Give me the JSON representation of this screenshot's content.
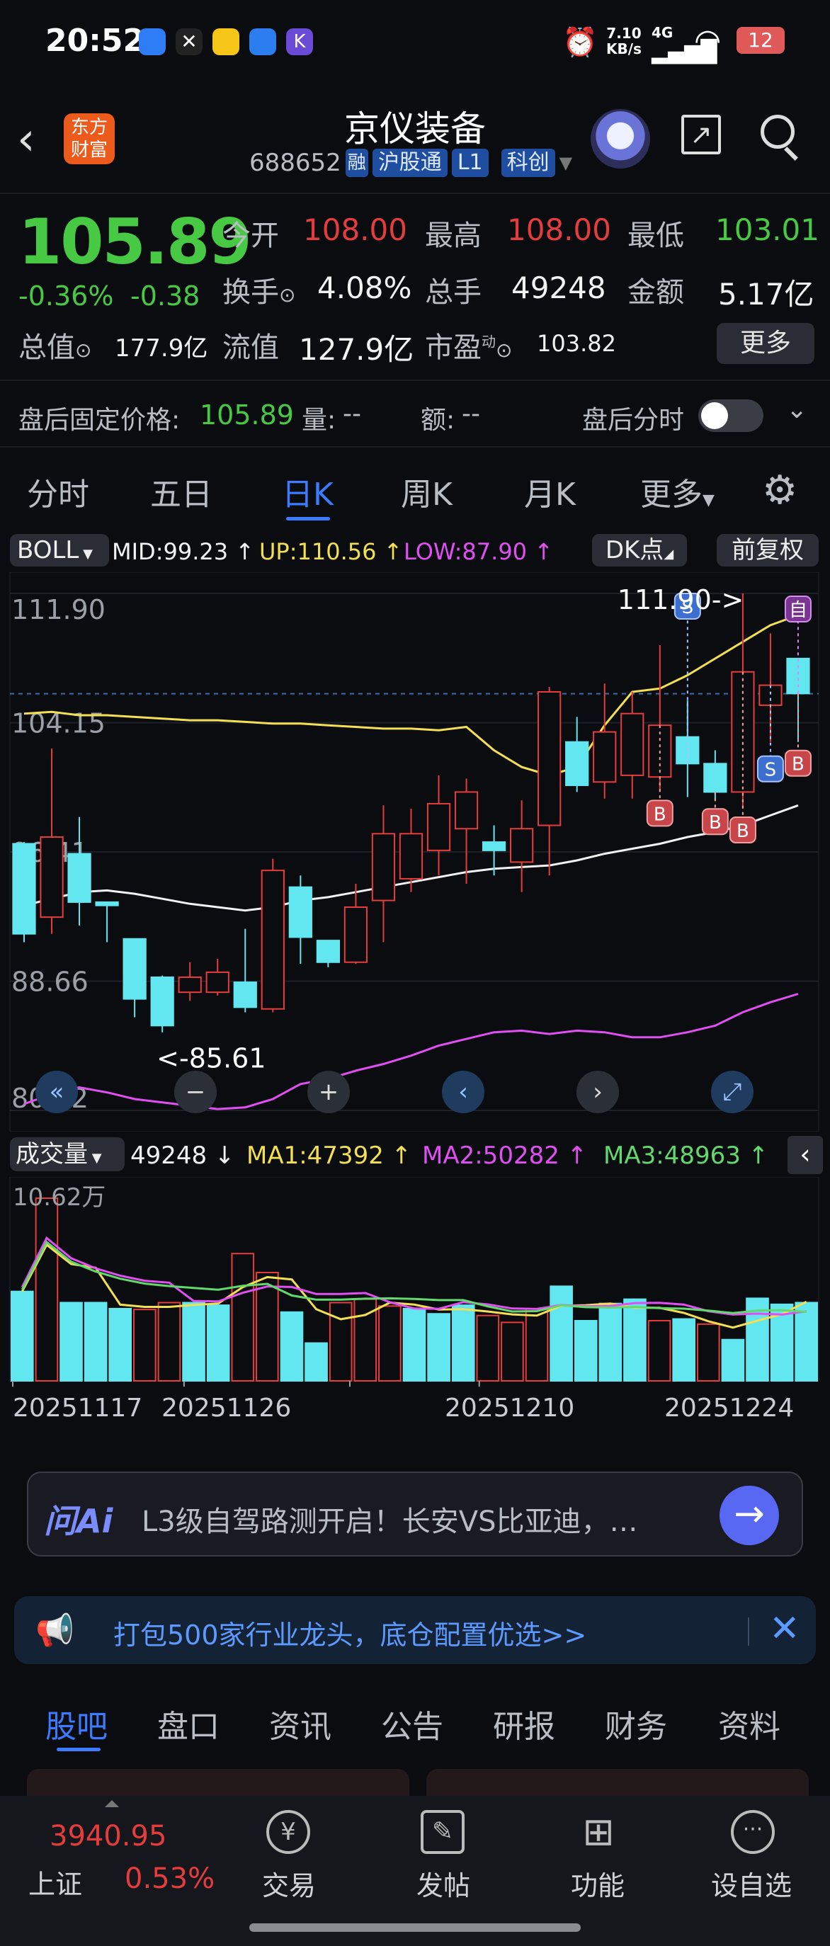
{
  "status_bar": {
    "time": "20:52",
    "net_speed_top": "7.10",
    "net_speed_bottom": "KB/s",
    "signal": "4G",
    "battery": "12"
  },
  "header": {
    "title": "京仪装备",
    "code": "688652",
    "badges": [
      "融",
      "沪股通",
      "L1",
      "科创"
    ],
    "logo_line1": "东方",
    "logo_line2": "财富"
  },
  "quote": {
    "price": "105.89",
    "change_pct": "-0.36%",
    "change_abs": "-0.38",
    "open_label": "今开",
    "open": "108.00",
    "high_label": "最高",
    "high": "108.00",
    "low_label": "最低",
    "low": "103.01",
    "turnover_label": "换手",
    "turnover": "4.08%",
    "volume_label": "总手",
    "volume": "49248",
    "amount_label": "金额",
    "amount": "5.17亿",
    "mktcap_label": "总值",
    "mktcap": "177.9亿",
    "float_label": "流值",
    "float": "127.9亿",
    "pe_label": "市盈",
    "pe_sup": "动",
    "pe": "103.82",
    "more_label": "更多"
  },
  "after_hours": {
    "price_label": "盘后固定价格:",
    "price": "105.89",
    "vol_label": "量:",
    "vol": "--",
    "amt_label": "额:",
    "amt": "--",
    "toggle_label": "盘后分时"
  },
  "period_tabs": [
    "分时",
    "五日",
    "日K",
    "周K",
    "月K",
    "更多"
  ],
  "active_tab": 2,
  "boll": {
    "name": "BOLL",
    "mid": "MID:99.23",
    "up": "UP:110.56",
    "low": "LOW:87.90",
    "dk": "DK点",
    "adjust": "前复权"
  },
  "chart_data": {
    "type": "candlestick",
    "y_ticks": [
      "111.90",
      "104.15",
      "96.41",
      "88.66",
      "80.92"
    ],
    "ylim": [
      80.92,
      111.9
    ],
    "max_label": "111.90->",
    "min_label": "<-85.61",
    "candles": [
      {
        "o": 96.9,
        "h": 97.0,
        "c": 91.5,
        "l": 91.0
      },
      {
        "o": 92.5,
        "h": 102.6,
        "c": 97.3,
        "l": 91.5
      },
      {
        "o": 96.3,
        "h": 98.5,
        "c": 93.4,
        "l": 92.0
      },
      {
        "o": 93.4,
        "h": 93.4,
        "c": 93.2,
        "l": 91.0
      },
      {
        "o": 91.2,
        "h": 91.2,
        "c": 87.6,
        "l": 86.5
      },
      {
        "o": 88.9,
        "h": 89.0,
        "c": 86.0,
        "l": 85.6
      },
      {
        "o": 88.0,
        "h": 89.8,
        "c": 88.9,
        "l": 87.5
      },
      {
        "o": 88.0,
        "h": 90.0,
        "c": 89.2,
        "l": 87.8
      },
      {
        "o": 88.6,
        "h": 91.8,
        "c": 87.1,
        "l": 86.8
      },
      {
        "o": 87.0,
        "h": 96.0,
        "c": 95.3,
        "l": 86.8
      },
      {
        "o": 94.3,
        "h": 95.0,
        "c": 91.3,
        "l": 89.7
      },
      {
        "o": 91.1,
        "h": 91.1,
        "c": 89.8,
        "l": 89.5
      },
      {
        "o": 89.8,
        "h": 94.5,
        "c": 93.1,
        "l": 89.7
      },
      {
        "o": 93.5,
        "h": 99.2,
        "c": 97.5,
        "l": 91.0
      },
      {
        "o": 94.8,
        "h": 99.0,
        "c": 97.5,
        "l": 94.0
      },
      {
        "o": 96.5,
        "h": 101.0,
        "c": 99.3,
        "l": 95.0
      },
      {
        "o": 97.8,
        "h": 100.8,
        "c": 100.0,
        "l": 94.5
      },
      {
        "o": 97.0,
        "h": 98.0,
        "c": 96.5,
        "l": 95.0
      },
      {
        "o": 95.8,
        "h": 99.5,
        "c": 97.8,
        "l": 94.0
      },
      {
        "o": 98.0,
        "h": 106.3,
        "c": 106.0,
        "l": 95.0
      },
      {
        "o": 103.0,
        "h": 104.5,
        "c": 100.4,
        "l": 100.0
      },
      {
        "o": 100.6,
        "h": 106.5,
        "c": 103.6,
        "l": 99.6
      },
      {
        "o": 101.0,
        "h": 106.0,
        "c": 104.7,
        "l": 99.6
      },
      {
        "o": 100.9,
        "h": 108.8,
        "c": 104.0,
        "l": 100.0
      },
      {
        "o": 103.3,
        "h": 105.5,
        "c": 101.7,
        "l": 99.7
      },
      {
        "o": 101.7,
        "h": 102.5,
        "c": 100.0,
        "l": 99.5
      },
      {
        "o": 100.0,
        "h": 111.9,
        "c": 107.2,
        "l": 99.0
      },
      {
        "o": 105.2,
        "h": 109.5,
        "c": 106.4,
        "l": 103.0
      },
      {
        "o": 108.0,
        "h": 108.0,
        "c": 105.9,
        "l": 103.0
      }
    ],
    "boll_up": [
      104.7,
      104.8,
      104.6,
      104.6,
      104.5,
      104.4,
      104.3,
      104.3,
      104.2,
      104.1,
      104.1,
      104.0,
      103.9,
      103.8,
      103.8,
      103.7,
      103.9,
      102.5,
      101.5,
      101.0,
      101.5,
      104.0,
      106.0,
      106.2,
      107.0,
      108.0,
      109.0,
      110.0,
      110.6
    ],
    "boll_mid": [
      93.2,
      93.6,
      94.0,
      94.1,
      93.9,
      93.6,
      93.3,
      93.1,
      92.9,
      93.1,
      93.5,
      93.7,
      94.0,
      94.3,
      94.6,
      94.9,
      95.2,
      95.4,
      95.5,
      95.6,
      95.9,
      96.3,
      96.6,
      96.9,
      97.3,
      97.6,
      98.0,
      98.6,
      99.2
    ],
    "boll_low": [
      81.3,
      81.9,
      82.3,
      82.0,
      81.6,
      81.4,
      81.2,
      81.0,
      81.1,
      81.6,
      82.5,
      82.8,
      83.3,
      83.7,
      84.2,
      84.8,
      85.2,
      85.6,
      85.7,
      85.5,
      85.7,
      85.6,
      85.3,
      85.3,
      85.6,
      86.0,
      86.8,
      87.4,
      87.9
    ],
    "signals": [
      {
        "i": 23,
        "t": "B"
      },
      {
        "i": 25,
        "t": "B"
      },
      {
        "i": 26,
        "t": "B"
      },
      {
        "i": 28,
        "t": "B"
      },
      {
        "i": 24,
        "t": "S"
      },
      {
        "i": 27,
        "t": "S"
      },
      {
        "i": 28,
        "t": "自"
      }
    ]
  },
  "nav": [
    "«",
    "−",
    "+",
    "‹",
    "›",
    "⤢"
  ],
  "volume": {
    "label": "成交量",
    "value": "49248 ↓",
    "ma1": "MA1:47392 ↑",
    "ma2": "MA2:50282 ↑",
    "ma3": "MA3:48963 ↑",
    "top_tick": "10.62万",
    "ymax": 106200,
    "bars": [
      52000,
      106200,
      45500,
      45500,
      42000,
      41500,
      45500,
      45500,
      44000,
      74000,
      63000,
      40000,
      22000,
      45500,
      47500,
      43500,
      42000,
      39000,
      44000,
      38000,
      34000,
      42000,
      55000,
      35000,
      45000,
      47500,
      35000,
      36000,
      33000,
      24000,
      48000,
      44500,
      45500
    ],
    "dates": [
      "20251117",
      "20251126",
      "20251210",
      "20251224"
    ]
  },
  "ai_bar": {
    "brand": "问Ai",
    "text": "L3级自驾路测开启！长安VS比亚迪，…"
  },
  "promo": {
    "text": "打包500家行业龙头，底仓配置优选>>"
  },
  "info_tabs": [
    "股吧",
    "盘口",
    "资讯",
    "公告",
    "研报",
    "财务",
    "资料"
  ],
  "index": {
    "name": "上证",
    "value": "3940.95",
    "pct": "0.53%"
  },
  "bottom_nav": [
    "交易",
    "发帖",
    "功能",
    "设自选"
  ],
  "colors": {
    "up": "#e53c3c",
    "down": "#62e7f0",
    "accent": "#3a7bff"
  }
}
